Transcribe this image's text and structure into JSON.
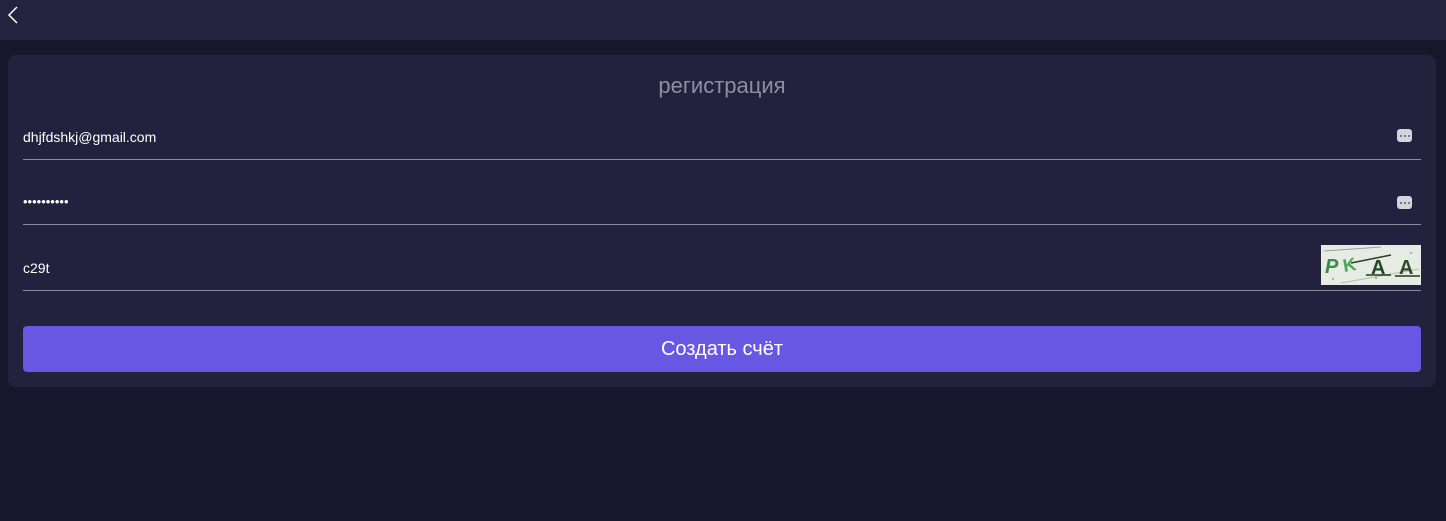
{
  "header": {
    "back_icon": "chevron-left-icon"
  },
  "form": {
    "title": "регистрация",
    "email_value": "dhjfdshkj@gmail.com",
    "password_value": "••••••••••",
    "captcha_value": "c29t",
    "captcha_image_text": "PKAA",
    "key_icon": "password-manager-icon",
    "submit_label": "Создать счёт"
  },
  "colors": {
    "page_bg": "#17172b",
    "panel_bg": "#22223f",
    "accent": "#6857e3",
    "title": "#8e8ea3"
  }
}
